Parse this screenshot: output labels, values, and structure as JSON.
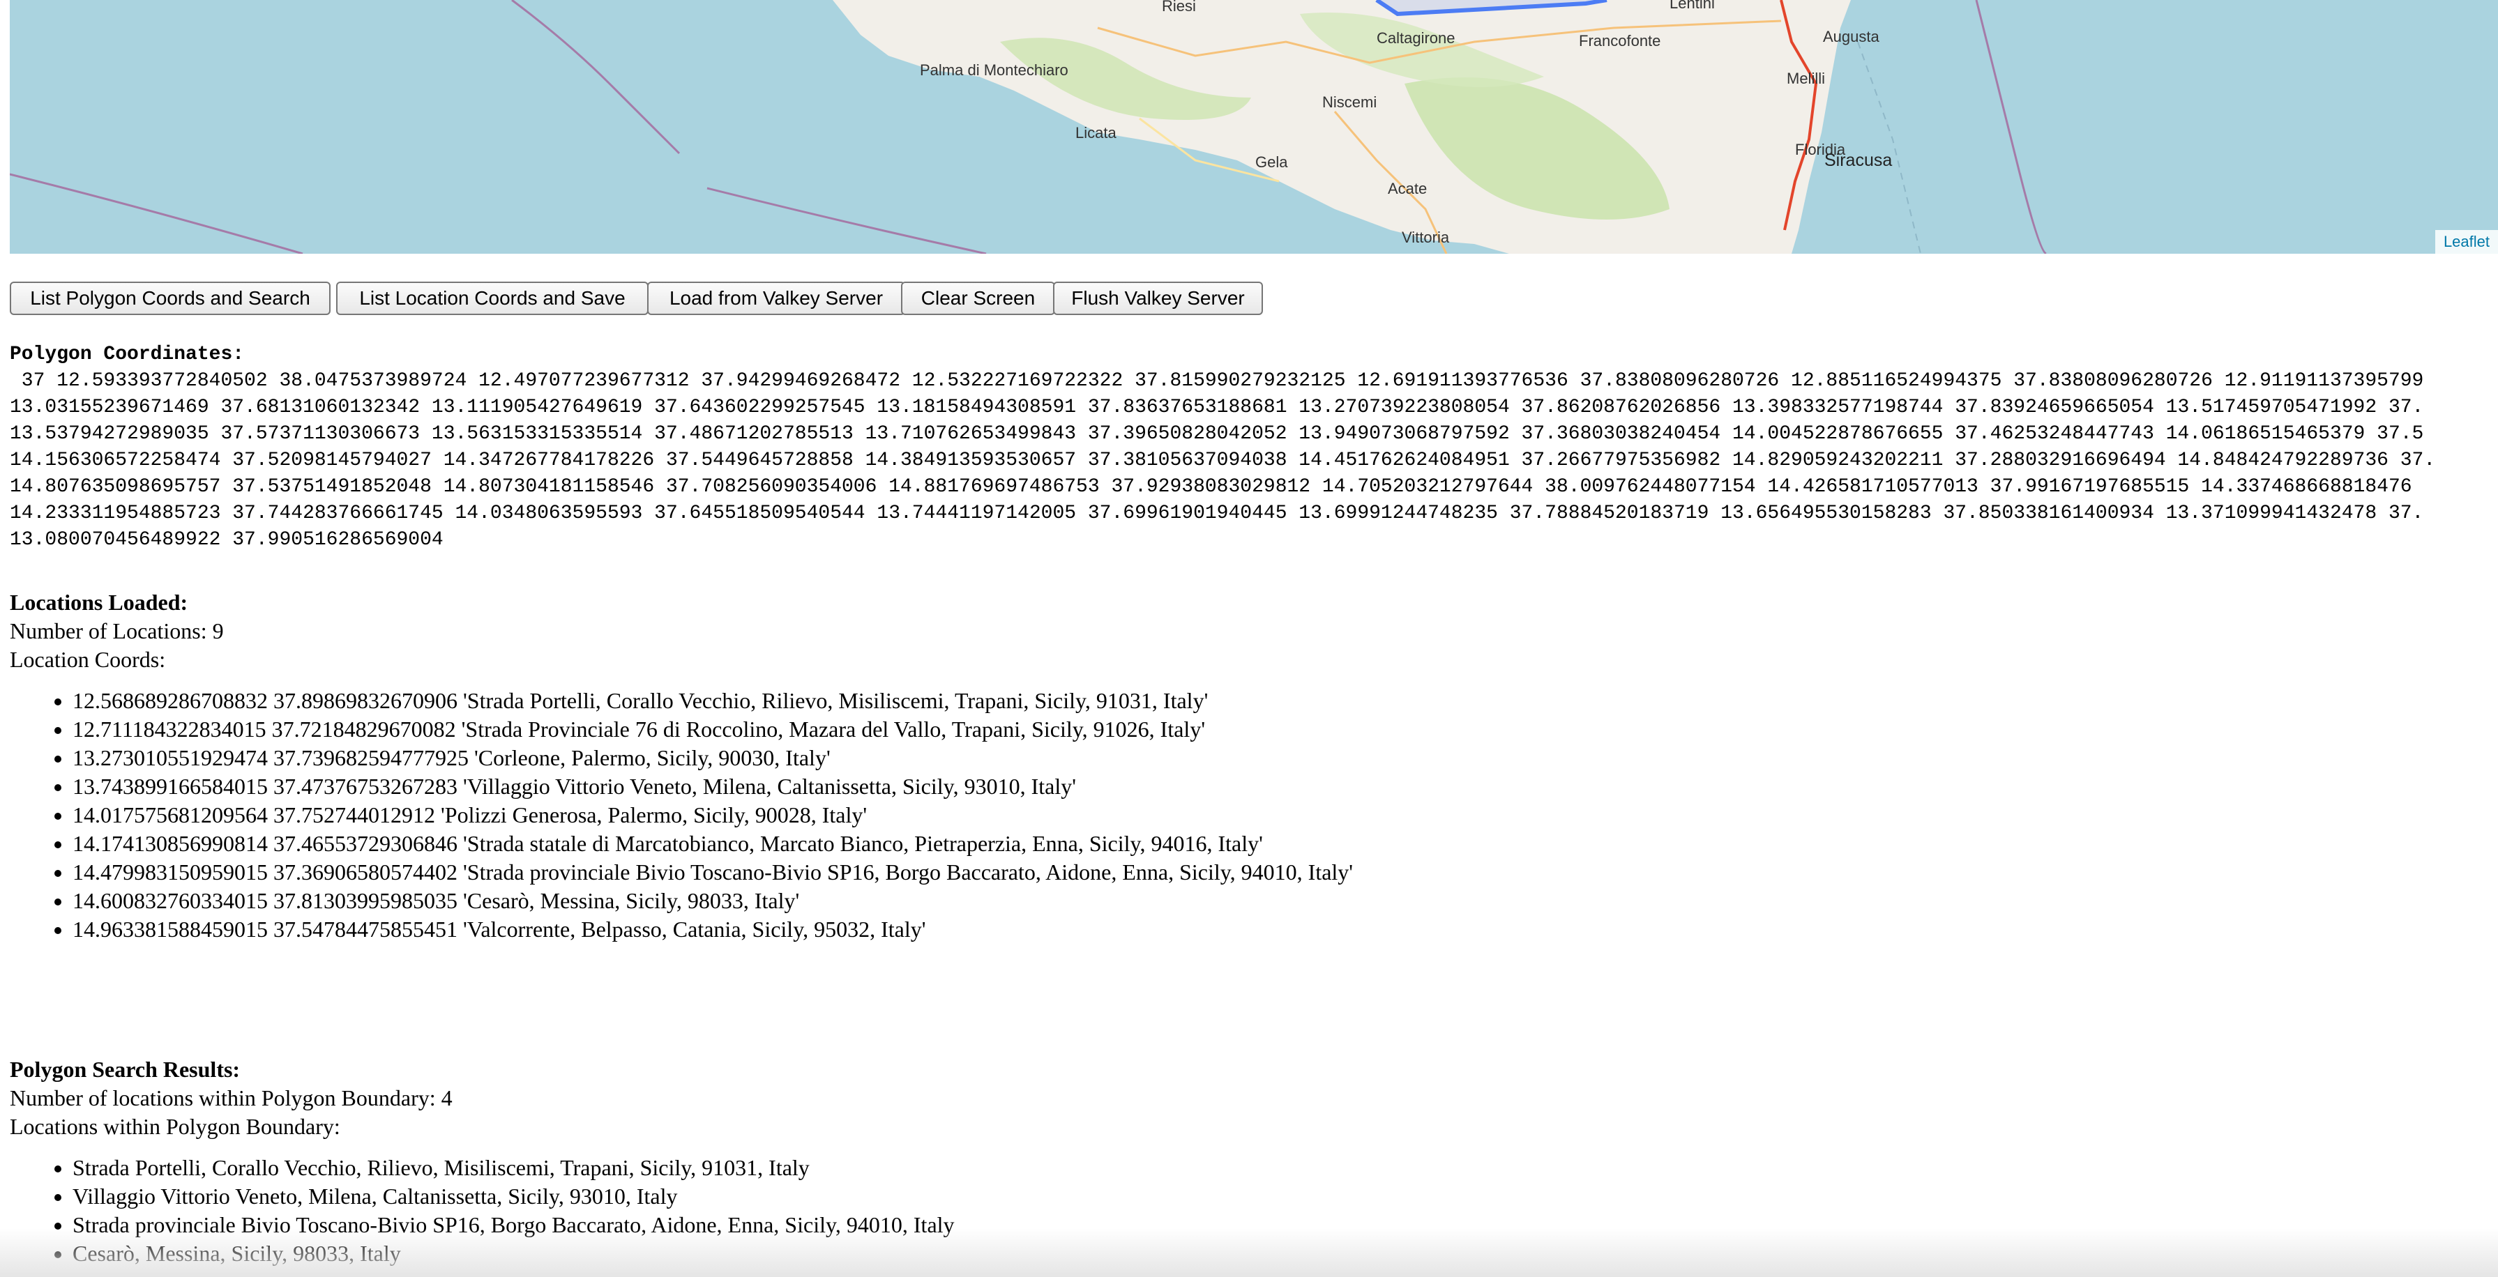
{
  "map": {
    "attribution": "Leaflet",
    "places": [
      "Riesi",
      "Lentini",
      "Caltagirone",
      "Francofonte",
      "Augusta",
      "Palma di Montechiaro",
      "Melilli",
      "Niscemi",
      "Licata",
      "Floridia",
      "Siracusa",
      "Gela",
      "Acate",
      "Vittoria"
    ]
  },
  "toolbar": {
    "list_polygon_label": "List Polygon Coords and Search",
    "list_location_label": "List Location Coords and Save",
    "load_label": "Load from Valkey Server",
    "clear_label": "Clear Screen",
    "flush_label": "Flush Valkey Server"
  },
  "polygon": {
    "heading": "Polygon Coordinates:",
    "lines": [
      " 37 12.593393772840502 38.0475373989724 12.497077239677312 37.94299469268472 12.532227169722322 37.815990279232125 12.691911393776536 37.83808096280726 12.885116524994375 37.83808096280726 12.91191137395799",
      "13.03155239671469 37.68131060132342 13.111905427649619 37.643602299257545 13.18158494308591 37.83637653188681 13.270739223808054 37.86208762026856 13.398332577198744 37.83924659665054 13.517459705471992 37.",
      "13.53794272989035 37.57371130306673 13.563153315335514 37.48671202785513 13.710762653499843 37.39650828042052 13.949073068797592 37.36803038240454 14.004522878676655 37.46253248447743 14.06186515465379 37.5",
      "14.156306572258474 37.52098145794027 14.347267784178226 37.5449645728858 14.384913593530657 37.38105637094038 14.451762624084951 37.26677975356982 14.829059243202211 37.288032916696494 14.848424792289736 37.",
      "14.807635098695757 37.53751491852048 14.807304181158546 37.708256090354006 14.881769697486753 37.92938083029812 14.705203212797644 38.009762448077154 14.426581710577013 37.99167197685515 14.337468668818476 ",
      "14.233311954885723 37.744283766661745 14.0348063595593 37.645518509540544 13.74441197142005 37.69961901940445 13.69991244748235 37.78884520183719 13.656495530158283 37.850338161400934 13.371099941432478 37.",
      "13.080070456489922 37.990516286569004"
    ]
  },
  "locations": {
    "heading": "Locations Loaded:",
    "count_text": "Number of Locations: 9",
    "coords_label": "Location Coords:",
    "items": [
      "12.568689286708832 37.89869832670906 'Strada Portelli, Corallo Vecchio, Rilievo, Misiliscemi, Trapani, Sicily, 91031, Italy'",
      "12.711184322834015 37.72184829670082 'Strada Provinciale 76 di Roccolino, Mazara del Vallo, Trapani, Sicily, 91026, Italy'",
      "13.273010551929474 37.739682594777925 'Corleone, Palermo, Sicily, 90030, Italy'",
      "13.743899166584015 37.47376753267283 'Villaggio Vittorio Veneto, Milena, Caltanissetta, Sicily, 93010, Italy'",
      "14.017575681209564 37.752744012912 'Polizzi Generosa, Palermo, Sicily, 90028, Italy'",
      "14.174130856990814 37.46553729306846 'Strada statale di Marcatobianco, Marcato Bianco, Pietraperzia, Enna, Sicily, 94016, Italy'",
      "14.479983150959015 37.36906580574402 'Strada provinciale Bivio Toscano-Bivio SP16, Borgo Baccarato, Aidone, Enna, Sicily, 94010, Italy'",
      "14.600832760334015 37.81303995985035 'Cesarò, Messina, Sicily, 98033, Italy'",
      "14.963381588459015 37.54784475855451 'Valcorrente, Belpasso, Catania, Sicily, 95032, Italy'"
    ]
  },
  "search": {
    "heading": "Polygon Search Results:",
    "count_text": "Number of locations within Polygon Boundary: 4",
    "within_label": "Locations within Polygon Boundary:",
    "items": [
      "Strada Portelli, Corallo Vecchio, Rilievo, Misiliscemi, Trapani, Sicily, 91031, Italy",
      "Villaggio Vittorio Veneto, Milena, Caltanissetta, Sicily, 93010, Italy",
      "Strada provinciale Bivio Toscano-Bivio SP16, Borgo Baccarato, Aidone, Enna, Sicily, 94010, Italy",
      "Cesarò, Messina, Sicily, 98033, Italy"
    ]
  }
}
